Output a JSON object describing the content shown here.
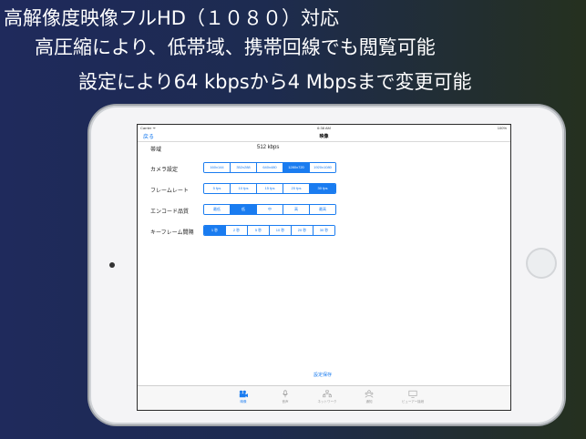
{
  "headlines": {
    "line1": "高解像度映像フルHD（１０８０）対応",
    "line2": "高圧縮により、低帯域、携帯回線でも閲覧可能",
    "line3": "設定により64 kbpsから4 Mbpsまで変更可能"
  },
  "statusbar": {
    "carrier": "Carrier ᯤ",
    "time": "6:38 AM",
    "battery": "100%"
  },
  "navbar": {
    "back": "戻る",
    "title": "映像"
  },
  "settings": {
    "bandwidth": {
      "label": "帯域",
      "value": "512 kbps"
    },
    "camera": {
      "label": "カメラ設定",
      "options": [
        "160x144",
        "352x288",
        "640x480",
        "1280x720",
        "1920x1080"
      ],
      "selected": "1280x720"
    },
    "framerate": {
      "label": "フレームレート",
      "options": [
        "5 fps",
        "10 fps",
        "15 fps",
        "20 fps",
        "30 fps"
      ],
      "selected": "30 fps"
    },
    "quality": {
      "label": "エンコード品質",
      "options": [
        "最低",
        "低",
        "中",
        "高",
        "最高"
      ],
      "selected": "低"
    },
    "keyframe": {
      "label": "キーフレーム間隔",
      "options": [
        "1 秒",
        "2 秒",
        "5 秒",
        "10 秒",
        "20 秒",
        "30 秒"
      ],
      "selected": "1 秒"
    }
  },
  "save_label": "設定保存",
  "tabs": [
    {
      "label": "映像",
      "icon": "video-camera-icon",
      "active": true
    },
    {
      "label": "音声",
      "icon": "microphone-icon",
      "active": false
    },
    {
      "label": "ネットワーク",
      "icon": "network-icon",
      "active": false
    },
    {
      "label": "通知",
      "icon": "people-icon",
      "active": false
    },
    {
      "label": "ビューアー接続",
      "icon": "viewer-icon",
      "active": false
    }
  ],
  "colors": {
    "accent": "#1a7cf0",
    "background_left": "#1f2a5c",
    "background_right": "#25301f"
  }
}
